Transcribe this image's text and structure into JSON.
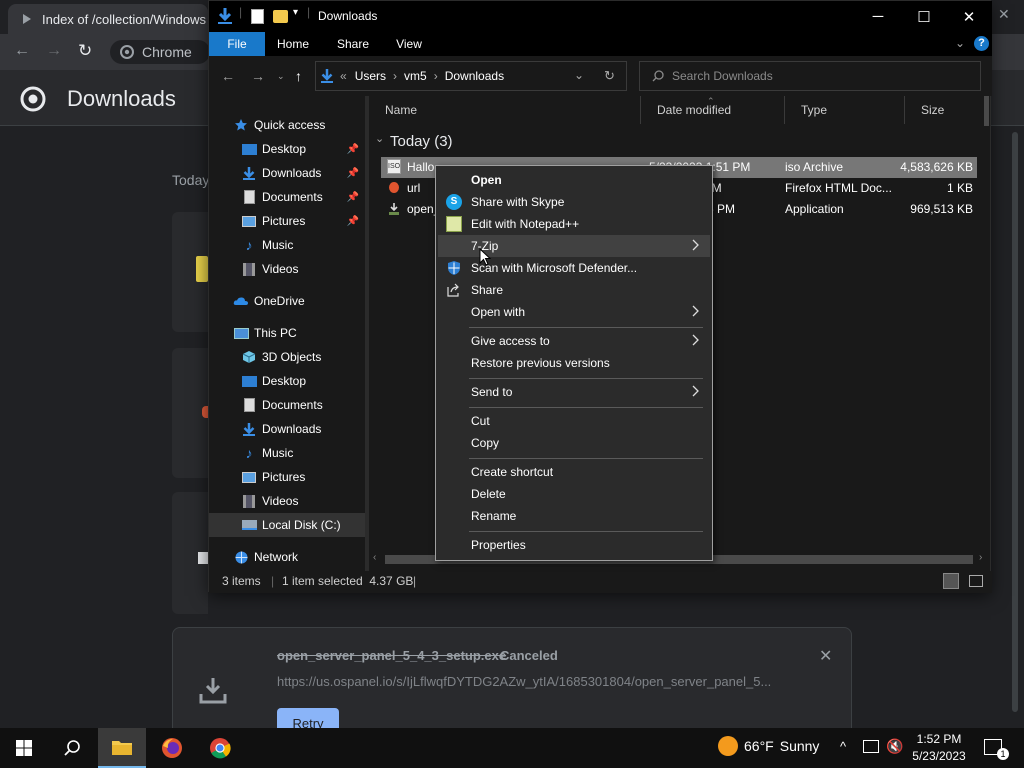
{
  "chrome": {
    "tab_title": "Index of /collection/Windows &",
    "omnibox_label": "Chrome",
    "page_title": "Downloads",
    "today_label": "Today",
    "download": {
      "filename": "open_server_panel_5_4_3_setup.exe",
      "status": "Canceled",
      "url": "https://us.ospanel.io/s/IjLflwqfDYTDG2AZw_ytIA/1685301804/open_server_panel_5...",
      "retry_label": "Retry"
    }
  },
  "explorer": {
    "title": "Downloads",
    "ribbon_tabs": [
      "File",
      "Home",
      "Share",
      "View"
    ],
    "breadcrumb": [
      "Users",
      "vm5",
      "Downloads"
    ],
    "breadcrumb_prefix": "«",
    "search_placeholder": "Search Downloads",
    "nav": {
      "quick_access": "Quick access",
      "qa_items": [
        "Desktop",
        "Downloads",
        "Documents",
        "Pictures",
        "Music",
        "Videos"
      ],
      "onedrive": "OneDrive",
      "this_pc": "This PC",
      "pc_items": [
        "3D Objects",
        "Desktop",
        "Documents",
        "Downloads",
        "Music",
        "Pictures",
        "Videos",
        "Local Disk (C:)"
      ],
      "network": "Network"
    },
    "columns": {
      "name": "Name",
      "date": "Date modified",
      "type": "Type",
      "size": "Size"
    },
    "group_label": "Today (3)",
    "files": [
      {
        "name": "Hallo",
        "date": "5/23/2023 1:51 PM",
        "type": "iso Archive",
        "size": "4,583,626 KB"
      },
      {
        "name": "url",
        "date": "05 PM",
        "type": "Firefox HTML Doc...",
        "size": "1 KB"
      },
      {
        "name": "open_",
        "date": ":36 PM",
        "type": "Application",
        "size": "969,513 KB"
      }
    ],
    "status": {
      "items": "3 items",
      "selected": "1 item selected  4.37 GB"
    }
  },
  "context_menu": {
    "items": [
      "Open",
      "Share with Skype",
      "Edit with Notepad++",
      "7-Zip",
      "Scan with Microsoft Defender...",
      "Share",
      "Open with",
      "Give access to",
      "Restore previous versions",
      "Send to",
      "Cut",
      "Copy",
      "Create shortcut",
      "Delete",
      "Rename",
      "Properties"
    ]
  },
  "taskbar": {
    "weather_temp": "66°F",
    "weather_desc": "Sunny",
    "time": "1:52 PM",
    "date": "5/23/2023",
    "notification_count": "1"
  },
  "colors": {
    "accent": "#1979ca",
    "chrome_bg": "#202124",
    "retry": "#8ab4f8"
  }
}
